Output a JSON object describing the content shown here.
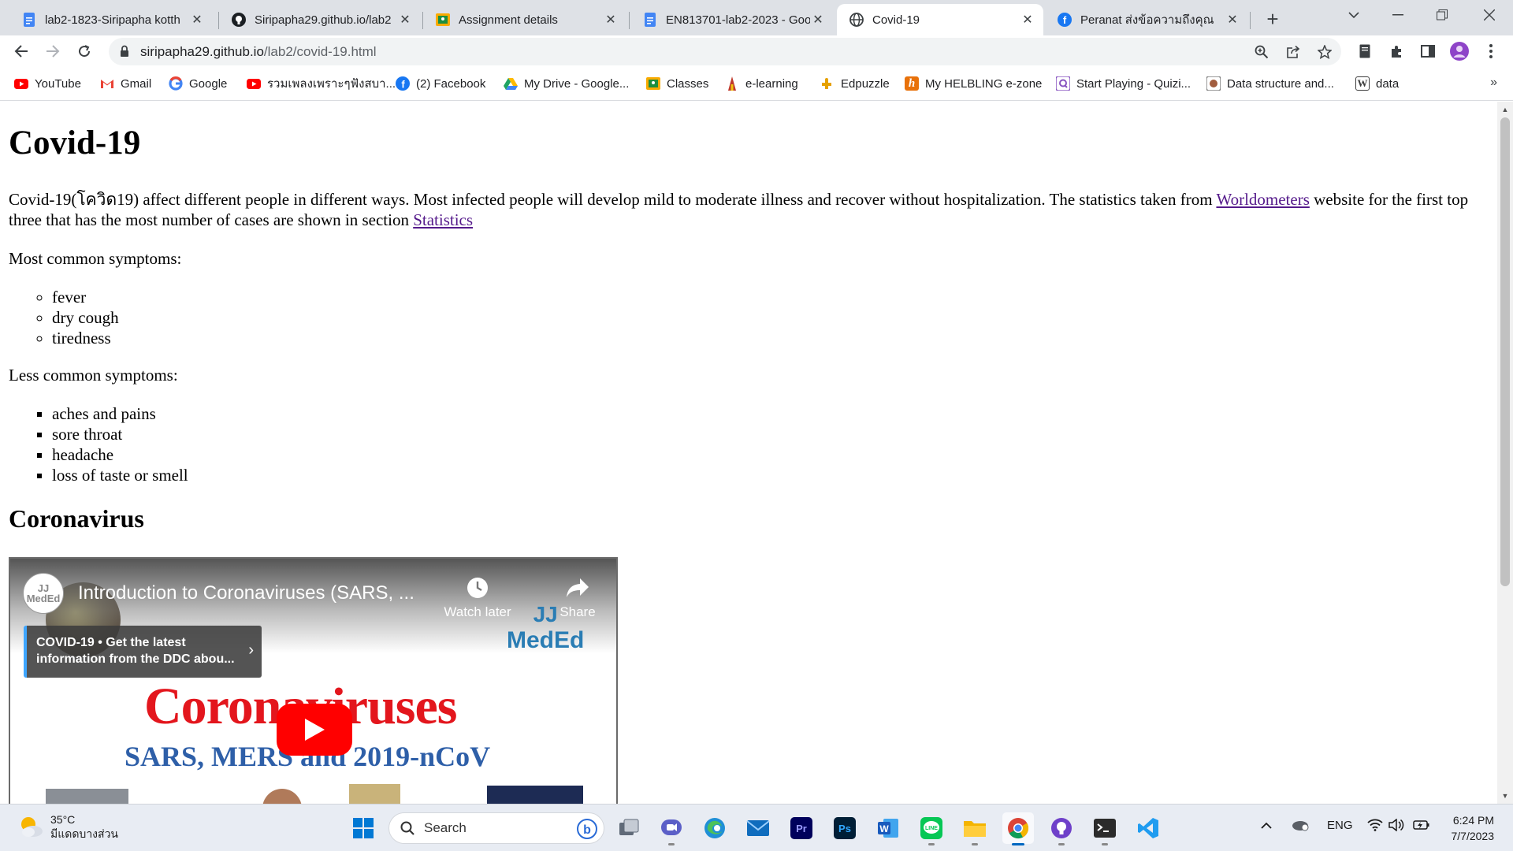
{
  "browser": {
    "tabs": [
      {
        "title": "lab2-1823-Siripapha kotth",
        "icon": "google-docs-icon",
        "active": false
      },
      {
        "title": "Siripapha29.github.io/lab2",
        "icon": "github-icon",
        "active": false
      },
      {
        "title": "Assignment details",
        "icon": "google-classroom-icon",
        "active": false
      },
      {
        "title": "EN813701-lab2-2023 - Goo",
        "icon": "google-docs-icon",
        "active": false
      },
      {
        "title": "Covid-19",
        "icon": "globe-icon",
        "active": true
      },
      {
        "title": "Peranat ส่งข้อความถึงคุณ",
        "icon": "facebook-icon",
        "active": false
      }
    ],
    "url_host": "siripapha29.github.io",
    "url_path": "/lab2/covid-19.html",
    "bookmarks": [
      {
        "label": "YouTube",
        "icon": "youtube-icon",
        "color": "#ff0000"
      },
      {
        "label": "Gmail",
        "icon": "gmail-icon",
        "color": "#ea4335"
      },
      {
        "label": "Google",
        "icon": "google-icon",
        "color": "#4285f4"
      },
      {
        "label": "รวมเพลงเพราะๆฟังสบา...",
        "icon": "youtube-icon",
        "color": "#ff0000"
      },
      {
        "label": "(2) Facebook",
        "icon": "facebook-icon",
        "color": "#1877f2"
      },
      {
        "label": "My Drive - Google...",
        "icon": "google-drive-icon",
        "color": "#1fa463"
      },
      {
        "label": "Classes",
        "icon": "google-classroom-icon",
        "color": "#f9ab00"
      },
      {
        "label": "e-learning",
        "icon": "e-learning-icon",
        "color": "#c0392b"
      },
      {
        "label": "Edpuzzle",
        "icon": "edpuzzle-icon",
        "color": "#e6a100"
      },
      {
        "label": "My HELBLING e-zone",
        "icon": "helbling-icon",
        "color": "#e8710a"
      },
      {
        "label": "Start Playing - Quizi...",
        "icon": "quizizz-icon",
        "color": "#8854c0"
      },
      {
        "label": "Data structure and...",
        "icon": "data-structure-icon",
        "color": "#7a7a7a"
      },
      {
        "label": "data",
        "icon": "w-icon",
        "color": "#3c3c3c"
      }
    ],
    "more_bookmarks": "»"
  },
  "page": {
    "heading": "Covid-19",
    "intro_before_link": "Covid-19(โควิด19) affect different people in different ways. Most infected people will develop mild to moderate illness and recover without hospitalization. The statistics taken from ",
    "worldometers_link": "Worldometers",
    "intro_middle": " website for the first top three that has the most number of cases are shown in section ",
    "statistics_link": "Statistics",
    "common_label": "Most common symptoms:",
    "common_symptoms": [
      "fever",
      "dry cough",
      "tiredness"
    ],
    "less_common_label": "Less common symptoms:",
    "less_common_symptoms": [
      "aches and pains",
      "sore throat",
      "headache",
      "loss of taste or smell"
    ],
    "section_heading": "Coronavirus"
  },
  "video": {
    "channel_logo": "JJ MedEd",
    "title": "Introduction to Coronaviruses (SARS, ...",
    "watch_later": "Watch later",
    "share": "Share",
    "brand_line1": "JJ",
    "brand_line2": "MedEd",
    "info_card": "COVID-19 • Get the latest information from the DDC abou...",
    "thumb_title": "Coronaviruses",
    "thumb_subtitle": "SARS, MERS and 2019-nCoV"
  },
  "taskbar": {
    "temperature": "35°C",
    "weather_desc": "มีแดดบางส่วน",
    "search_label": "Search",
    "language": "ENG",
    "time": "6:24 PM",
    "date": "7/7/2023"
  }
}
